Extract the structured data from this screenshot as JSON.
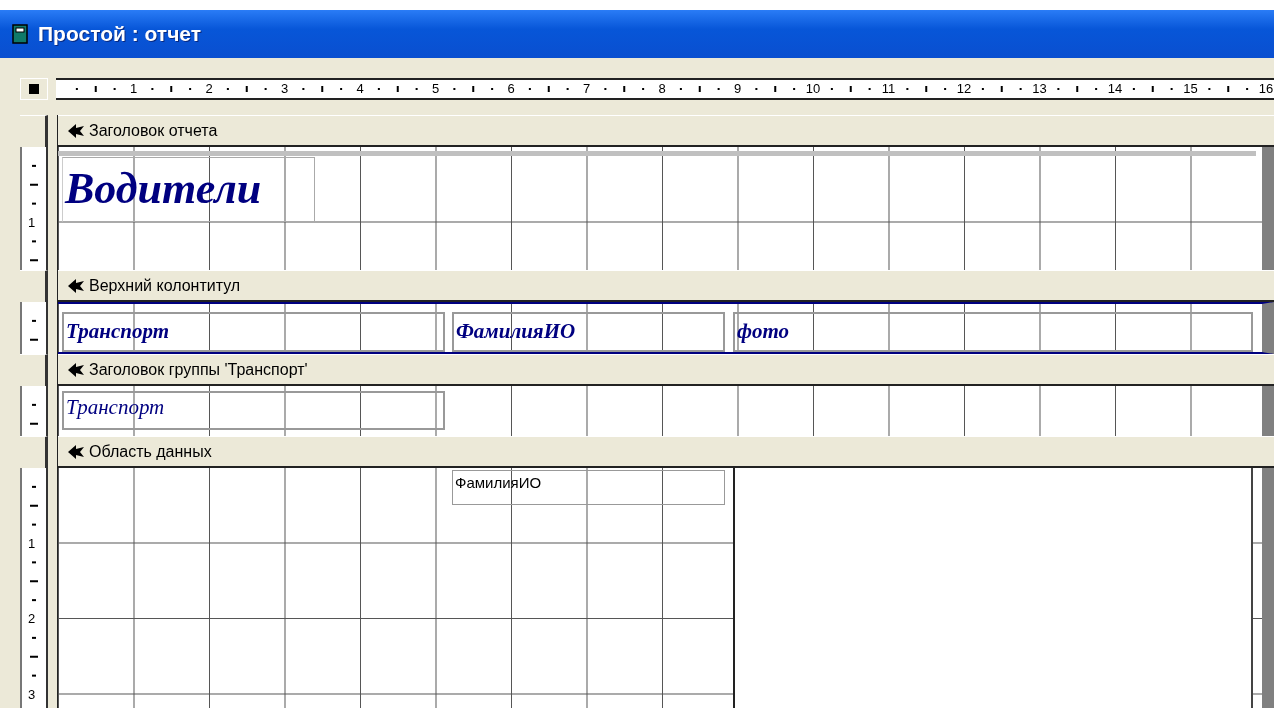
{
  "window": {
    "title": "Простой : отчет"
  },
  "ruler": {
    "numbers": [
      "1",
      "2",
      "3",
      "4",
      "5",
      "6",
      "7",
      "8",
      "9",
      "10",
      "11",
      "12",
      "13",
      "14",
      "15",
      "16"
    ]
  },
  "sections": [
    {
      "band": "Заголовок отчета",
      "ruler_numbers": [
        "1"
      ],
      "controls": [
        {
          "kind": "line"
        },
        {
          "kind": "title",
          "text": "Водители"
        }
      ]
    },
    {
      "band": "Верхний колонтитул",
      "controls": [
        {
          "kind": "label",
          "text": "Транспорт"
        },
        {
          "kind": "label",
          "text": "ФамилияИО"
        },
        {
          "kind": "label",
          "text": "фото"
        }
      ]
    },
    {
      "band": "Заголовок группы 'Транспорт'",
      "controls": [
        {
          "kind": "group_field",
          "text": "Транспорт"
        }
      ]
    },
    {
      "band": "Область данных",
      "ruler_numbers": [
        "1",
        "2",
        "3"
      ],
      "controls": [
        {
          "kind": "field",
          "text": "ФамилияИО"
        },
        {
          "kind": "image"
        }
      ]
    }
  ]
}
